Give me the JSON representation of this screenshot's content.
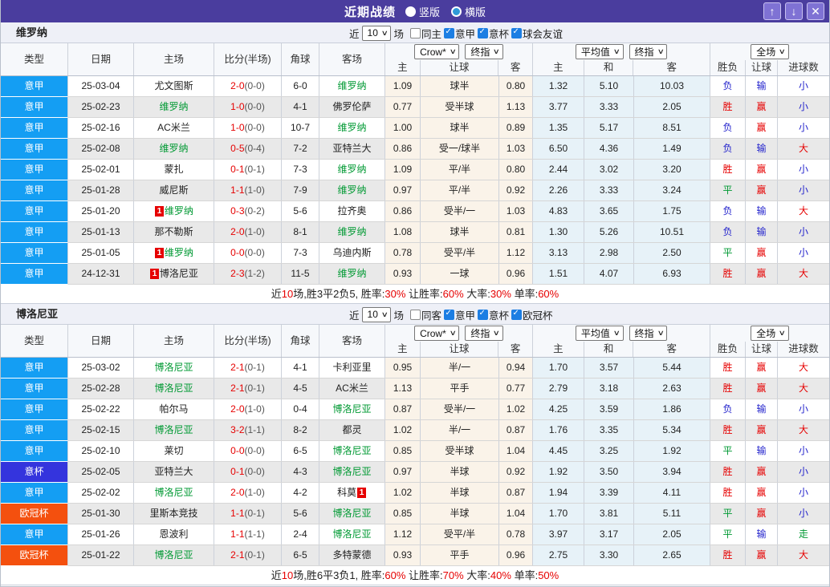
{
  "titlebar": {
    "title": "近期战绩",
    "radios": [
      {
        "label": "竖版",
        "selected": false
      },
      {
        "label": "横版",
        "selected": true
      }
    ],
    "buttons": {
      "up": "↑",
      "down": "↓",
      "close": "✕"
    }
  },
  "columns": {
    "left": [
      "类型",
      "日期",
      "主场",
      "比分(半场)",
      "角球",
      "客场"
    ],
    "group1": {
      "selects": [
        "Crow*",
        "终指"
      ],
      "cols": [
        "主",
        "让球",
        "客"
      ]
    },
    "group2": {
      "selects": [
        "平均值",
        "终指"
      ],
      "cols": [
        "主",
        "和",
        "客"
      ]
    },
    "group3": {
      "selects": [
        "全场"
      ],
      "cols": [
        "胜负",
        "让球",
        "进球数"
      ]
    }
  },
  "league_colors": {
    "意甲": "#149ef3",
    "意杯": "#3434dd",
    "欧冠杯": "#f4500e"
  },
  "result_colors": {
    "red": "#e60000",
    "blue": "#2323cc",
    "green": "#009933"
  },
  "sections": [
    {
      "team": "维罗纳",
      "filter": {
        "near": "近",
        "count": "10",
        "games": "场",
        "same": {
          "label": "同主",
          "checked": false
        },
        "leagues": [
          {
            "label": "意甲",
            "checked": true
          },
          {
            "label": "意杯",
            "checked": true
          },
          {
            "label": "球会友谊",
            "checked": true
          }
        ]
      },
      "rows": [
        {
          "league": "意甲",
          "date": "25-03-04",
          "home": {
            "name": "尤文图斯"
          },
          "score": "2-0",
          "half": "(0-0)",
          "corner": "6-0",
          "away": {
            "name": "维罗纳",
            "focus": true
          },
          "odds": [
            "1.09",
            "球半",
            "0.80"
          ],
          "avg": [
            "1.32",
            "5.10",
            "10.03"
          ],
          "results": [
            {
              "text": "负",
              "color": "blue"
            },
            {
              "text": "输",
              "color": "blue"
            },
            {
              "text": "小",
              "color": "blue"
            }
          ]
        },
        {
          "league": "意甲",
          "date": "25-02-23",
          "home": {
            "name": "维罗纳",
            "focus": true
          },
          "score": "1-0",
          "half": "(0-0)",
          "corner": "4-1",
          "away": {
            "name": "佛罗伦萨"
          },
          "odds": [
            "0.77",
            "受半球",
            "1.13"
          ],
          "avg": [
            "3.77",
            "3.33",
            "2.05"
          ],
          "results": [
            {
              "text": "胜",
              "color": "red"
            },
            {
              "text": "赢",
              "color": "red"
            },
            {
              "text": "小",
              "color": "blue"
            }
          ]
        },
        {
          "league": "意甲",
          "date": "25-02-16",
          "home": {
            "name": "AC米兰"
          },
          "score": "1-0",
          "half": "(0-0)",
          "corner": "10-7",
          "away": {
            "name": "维罗纳",
            "focus": true
          },
          "odds": [
            "1.00",
            "球半",
            "0.89"
          ],
          "avg": [
            "1.35",
            "5.17",
            "8.51"
          ],
          "results": [
            {
              "text": "负",
              "color": "blue"
            },
            {
              "text": "赢",
              "color": "red"
            },
            {
              "text": "小",
              "color": "blue"
            }
          ]
        },
        {
          "league": "意甲",
          "date": "25-02-08",
          "home": {
            "name": "维罗纳",
            "focus": true
          },
          "score": "0-5",
          "half": "(0-4)",
          "corner": "7-2",
          "away": {
            "name": "亚特兰大"
          },
          "odds": [
            "0.86",
            "受一/球半",
            "1.03"
          ],
          "avg": [
            "6.50",
            "4.36",
            "1.49"
          ],
          "results": [
            {
              "text": "负",
              "color": "blue"
            },
            {
              "text": "输",
              "color": "blue"
            },
            {
              "text": "大",
              "color": "red"
            }
          ]
        },
        {
          "league": "意甲",
          "date": "25-02-01",
          "home": {
            "name": "蒙扎"
          },
          "score": "0-1",
          "half": "(0-1)",
          "corner": "7-3",
          "away": {
            "name": "维罗纳",
            "focus": true
          },
          "odds": [
            "1.09",
            "平/半",
            "0.80"
          ],
          "avg": [
            "2.44",
            "3.02",
            "3.20"
          ],
          "results": [
            {
              "text": "胜",
              "color": "red"
            },
            {
              "text": "赢",
              "color": "red"
            },
            {
              "text": "小",
              "color": "blue"
            }
          ]
        },
        {
          "league": "意甲",
          "date": "25-01-28",
          "home": {
            "name": "威尼斯"
          },
          "score": "1-1",
          "half": "(1-0)",
          "corner": "7-9",
          "away": {
            "name": "维罗纳",
            "focus": true
          },
          "odds": [
            "0.97",
            "平/半",
            "0.92"
          ],
          "avg": [
            "2.26",
            "3.33",
            "3.24"
          ],
          "results": [
            {
              "text": "平",
              "color": "green"
            },
            {
              "text": "赢",
              "color": "red"
            },
            {
              "text": "小",
              "color": "blue"
            }
          ]
        },
        {
          "league": "意甲",
          "date": "25-01-20",
          "home": {
            "name": "维罗纳",
            "focus": true,
            "card": "1",
            "card_pos": "before"
          },
          "score": "0-3",
          "half": "(0-2)",
          "corner": "5-6",
          "away": {
            "name": "拉齐奥"
          },
          "odds": [
            "0.86",
            "受半/一",
            "1.03"
          ],
          "avg": [
            "4.83",
            "3.65",
            "1.75"
          ],
          "results": [
            {
              "text": "负",
              "color": "blue"
            },
            {
              "text": "输",
              "color": "blue"
            },
            {
              "text": "大",
              "color": "red"
            }
          ]
        },
        {
          "league": "意甲",
          "date": "25-01-13",
          "home": {
            "name": "那不勒斯"
          },
          "score": "2-0",
          "half": "(1-0)",
          "corner": "8-1",
          "away": {
            "name": "维罗纳",
            "focus": true
          },
          "odds": [
            "1.08",
            "球半",
            "0.81"
          ],
          "avg": [
            "1.30",
            "5.26",
            "10.51"
          ],
          "results": [
            {
              "text": "负",
              "color": "blue"
            },
            {
              "text": "输",
              "color": "blue"
            },
            {
              "text": "小",
              "color": "blue"
            }
          ]
        },
        {
          "league": "意甲",
          "date": "25-01-05",
          "home": {
            "name": "维罗纳",
            "focus": true,
            "card": "1",
            "card_pos": "before"
          },
          "score": "0-0",
          "half": "(0-0)",
          "corner": "7-3",
          "away": {
            "name": "乌迪内斯"
          },
          "odds": [
            "0.78",
            "受平/半",
            "1.12"
          ],
          "avg": [
            "3.13",
            "2.98",
            "2.50"
          ],
          "results": [
            {
              "text": "平",
              "color": "green"
            },
            {
              "text": "赢",
              "color": "red"
            },
            {
              "text": "小",
              "color": "blue"
            }
          ]
        },
        {
          "league": "意甲",
          "date": "24-12-31",
          "home": {
            "name": "博洛尼亚",
            "card": "1",
            "card_pos": "before"
          },
          "score": "2-3",
          "half": "(1-2)",
          "corner": "11-5",
          "away": {
            "name": "维罗纳",
            "focus": true
          },
          "odds": [
            "0.93",
            "一球",
            "0.96"
          ],
          "avg": [
            "1.51",
            "4.07",
            "6.93"
          ],
          "results": [
            {
              "text": "胜",
              "color": "red"
            },
            {
              "text": "赢",
              "color": "red"
            },
            {
              "text": "大",
              "color": "red"
            }
          ]
        }
      ],
      "summary": [
        {
          "text": "近",
          "red": false
        },
        {
          "text": "10",
          "red": true
        },
        {
          "text": "场,胜3平2负5, 胜率:",
          "red": false
        },
        {
          "text": "30%",
          "red": true
        },
        {
          "text": " 让胜率:",
          "red": false
        },
        {
          "text": "60%",
          "red": true
        },
        {
          "text": " 大率:",
          "red": false
        },
        {
          "text": "30%",
          "red": true
        },
        {
          "text": " 单率:",
          "red": false
        },
        {
          "text": "60%",
          "red": true
        }
      ]
    },
    {
      "team": "博洛尼亚",
      "filter": {
        "near": "近",
        "count": "10",
        "games": "场",
        "same": {
          "label": "同客",
          "checked": false
        },
        "leagues": [
          {
            "label": "意甲",
            "checked": true
          },
          {
            "label": "意杯",
            "checked": true
          },
          {
            "label": "欧冠杯",
            "checked": true
          }
        ]
      },
      "rows": [
        {
          "league": "意甲",
          "date": "25-03-02",
          "home": {
            "name": "博洛尼亚",
            "focus": true
          },
          "score": "2-1",
          "half": "(0-1)",
          "corner": "4-1",
          "away": {
            "name": "卡利亚里"
          },
          "odds": [
            "0.95",
            "半/一",
            "0.94"
          ],
          "avg": [
            "1.70",
            "3.57",
            "5.44"
          ],
          "results": [
            {
              "text": "胜",
              "color": "red"
            },
            {
              "text": "赢",
              "color": "red"
            },
            {
              "text": "大",
              "color": "red"
            }
          ]
        },
        {
          "league": "意甲",
          "date": "25-02-28",
          "home": {
            "name": "博洛尼亚",
            "focus": true
          },
          "score": "2-1",
          "half": "(0-1)",
          "corner": "4-5",
          "away": {
            "name": "AC米兰"
          },
          "odds": [
            "1.13",
            "平手",
            "0.77"
          ],
          "avg": [
            "2.79",
            "3.18",
            "2.63"
          ],
          "results": [
            {
              "text": "胜",
              "color": "red"
            },
            {
              "text": "赢",
              "color": "red"
            },
            {
              "text": "大",
              "color": "red"
            }
          ]
        },
        {
          "league": "意甲",
          "date": "25-02-22",
          "home": {
            "name": "帕尔马"
          },
          "score": "2-0",
          "half": "(1-0)",
          "corner": "0-4",
          "away": {
            "name": "博洛尼亚",
            "focus": true
          },
          "odds": [
            "0.87",
            "受半/一",
            "1.02"
          ],
          "avg": [
            "4.25",
            "3.59",
            "1.86"
          ],
          "results": [
            {
              "text": "负",
              "color": "blue"
            },
            {
              "text": "输",
              "color": "blue"
            },
            {
              "text": "小",
              "color": "blue"
            }
          ]
        },
        {
          "league": "意甲",
          "date": "25-02-15",
          "home": {
            "name": "博洛尼亚",
            "focus": true
          },
          "score": "3-2",
          "half": "(1-1)",
          "corner": "8-2",
          "away": {
            "name": "都灵"
          },
          "odds": [
            "1.02",
            "半/一",
            "0.87"
          ],
          "avg": [
            "1.76",
            "3.35",
            "5.34"
          ],
          "results": [
            {
              "text": "胜",
              "color": "red"
            },
            {
              "text": "赢",
              "color": "red"
            },
            {
              "text": "大",
              "color": "red"
            }
          ]
        },
        {
          "league": "意甲",
          "date": "25-02-10",
          "home": {
            "name": "莱切"
          },
          "score": "0-0",
          "half": "(0-0)",
          "corner": "6-5",
          "away": {
            "name": "博洛尼亚",
            "focus": true
          },
          "odds": [
            "0.85",
            "受半球",
            "1.04"
          ],
          "avg": [
            "4.45",
            "3.25",
            "1.92"
          ],
          "results": [
            {
              "text": "平",
              "color": "green"
            },
            {
              "text": "输",
              "color": "blue"
            },
            {
              "text": "小",
              "color": "blue"
            }
          ]
        },
        {
          "league": "意杯",
          "date": "25-02-05",
          "home": {
            "name": "亚特兰大"
          },
          "score": "0-1",
          "half": "(0-0)",
          "corner": "4-3",
          "away": {
            "name": "博洛尼亚",
            "focus": true
          },
          "odds": [
            "0.97",
            "半球",
            "0.92"
          ],
          "avg": [
            "1.92",
            "3.50",
            "3.94"
          ],
          "results": [
            {
              "text": "胜",
              "color": "red"
            },
            {
              "text": "赢",
              "color": "red"
            },
            {
              "text": "小",
              "color": "blue"
            }
          ]
        },
        {
          "league": "意甲",
          "date": "25-02-02",
          "home": {
            "name": "博洛尼亚",
            "focus": true
          },
          "score": "2-0",
          "half": "(1-0)",
          "corner": "4-2",
          "away": {
            "name": "科莫",
            "card": "1",
            "card_pos": "after"
          },
          "odds": [
            "1.02",
            "半球",
            "0.87"
          ],
          "avg": [
            "1.94",
            "3.39",
            "4.11"
          ],
          "results": [
            {
              "text": "胜",
              "color": "red"
            },
            {
              "text": "赢",
              "color": "red"
            },
            {
              "text": "小",
              "color": "blue"
            }
          ]
        },
        {
          "league": "欧冠杯",
          "date": "25-01-30",
          "home": {
            "name": "里斯本竞技"
          },
          "score": "1-1",
          "half": "(0-1)",
          "corner": "5-6",
          "away": {
            "name": "博洛尼亚",
            "focus": true
          },
          "odds": [
            "0.85",
            "半球",
            "1.04"
          ],
          "avg": [
            "1.70",
            "3.81",
            "5.11"
          ],
          "results": [
            {
              "text": "平",
              "color": "green"
            },
            {
              "text": "赢",
              "color": "red"
            },
            {
              "text": "小",
              "color": "blue"
            }
          ]
        },
        {
          "league": "意甲",
          "date": "25-01-26",
          "home": {
            "name": "恩波利"
          },
          "score": "1-1",
          "half": "(1-1)",
          "corner": "2-4",
          "away": {
            "name": "博洛尼亚",
            "focus": true
          },
          "odds": [
            "1.12",
            "受平/半",
            "0.78"
          ],
          "avg": [
            "3.97",
            "3.17",
            "2.05"
          ],
          "results": [
            {
              "text": "平",
              "color": "green"
            },
            {
              "text": "输",
              "color": "blue"
            },
            {
              "text": "走",
              "color": "green"
            }
          ]
        },
        {
          "league": "欧冠杯",
          "date": "25-01-22",
          "home": {
            "name": "博洛尼亚",
            "focus": true
          },
          "score": "2-1",
          "half": "(0-1)",
          "corner": "6-5",
          "away": {
            "name": "多特蒙德"
          },
          "odds": [
            "0.93",
            "平手",
            "0.96"
          ],
          "avg": [
            "2.75",
            "3.30",
            "2.65"
          ],
          "results": [
            {
              "text": "胜",
              "color": "red"
            },
            {
              "text": "赢",
              "color": "red"
            },
            {
              "text": "大",
              "color": "red"
            }
          ]
        }
      ],
      "summary": [
        {
          "text": "近",
          "red": false
        },
        {
          "text": "10",
          "red": true
        },
        {
          "text": "场,胜6平3负1, 胜率:",
          "red": false
        },
        {
          "text": "60%",
          "red": true
        },
        {
          "text": " 让胜率:",
          "red": false
        },
        {
          "text": "70%",
          "red": true
        },
        {
          "text": " 大率:",
          "red": false
        },
        {
          "text": "40%",
          "red": true
        },
        {
          "text": " 单率:",
          "red": false
        },
        {
          "text": "50%",
          "red": true
        }
      ]
    }
  ]
}
